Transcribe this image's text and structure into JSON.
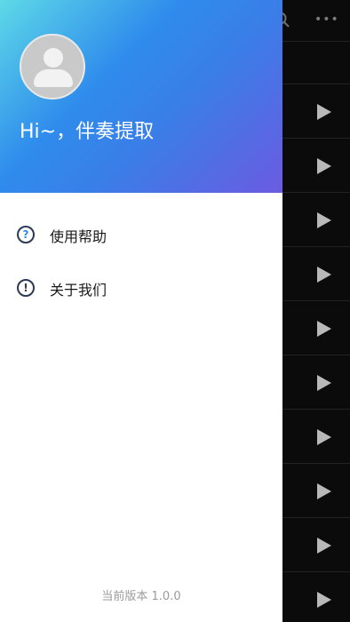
{
  "header": {
    "greeting": "Hi~，伴奏提取"
  },
  "menu": [
    {
      "label": "使用帮助",
      "icon": "question-icon"
    },
    {
      "label": "关于我们",
      "icon": "exclamation-icon"
    }
  ],
  "footer": {
    "version": "当前版本 1.0.0"
  },
  "background_list": {
    "row_count": 10,
    "icon": "play-icon"
  },
  "colors": {
    "drawer_header_gradient": [
      "#5ed9e8",
      "#2f8cec",
      "#6b5be0"
    ],
    "help_icon_accent": "#2d8de8"
  }
}
